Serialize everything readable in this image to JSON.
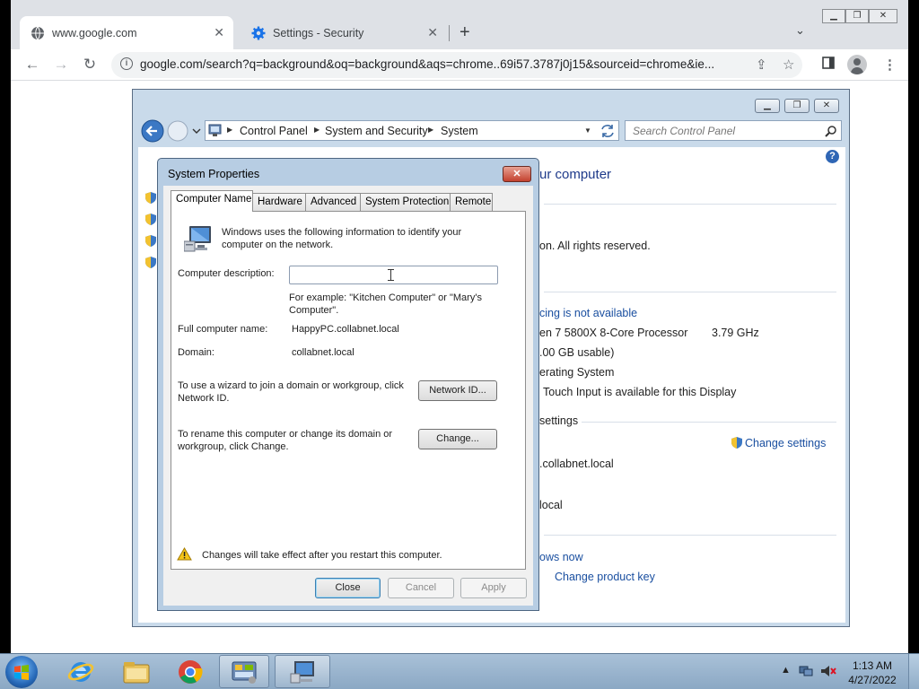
{
  "browser": {
    "tabs": [
      {
        "title": "www.google.com",
        "icon": "globe-icon"
      },
      {
        "title": "Settings - Security",
        "icon": "gear-icon"
      }
    ],
    "url": "google.com/search?q=background&oq=background&aqs=chrome..69i57.3787j0j15&sourceid=chrome&ie...",
    "accent": "#1a73e8"
  },
  "control_panel": {
    "breadcrumb": [
      "Control Panel",
      "System and Security",
      "System"
    ],
    "search_placeholder": "Search Control Panel",
    "content": {
      "heading_fragment": "ur computer",
      "copyright_fragment": "on.  All rights reserved.",
      "pen_fragment": "cing is not available",
      "processor_fragment": "en 7 5800X 8-Core Processor",
      "processor_speed": "3.79 GHz",
      "ram_fragment": ".00 GB usable)",
      "system_type_fragment": "erating System",
      "touch_fragment": "Touch Input is available for this Display",
      "settings_fragment": "settings",
      "change_settings": "Change settings",
      "computer_fragment": ".collabnet.local",
      "domain_fragment": "local",
      "activation_fragment": "ows now",
      "change_product_key": "Change product key"
    }
  },
  "system_properties": {
    "title": "System Properties",
    "tabs": [
      "Computer Name",
      "Hardware",
      "Advanced",
      "System Protection",
      "Remote"
    ],
    "intro": "Windows uses the following information to identify your computer on the network.",
    "description_label": "Computer description:",
    "description_value": "",
    "example": "For example: \"Kitchen Computer\" or \"Mary's Computer\".",
    "full_name_label": "Full computer name:",
    "full_name_value": "HappyPC.collabnet.local",
    "domain_label": "Domain:",
    "domain_value": "collabnet.local",
    "wizard_text": "To use a wizard to join a domain or workgroup, click Network ID.",
    "network_id_button": "Network ID...",
    "rename_text": "To rename this computer or change its domain or workgroup, click Change.",
    "change_button": "Change...",
    "warning": "Changes will take effect after you restart this computer.",
    "buttons": {
      "close": "Close",
      "cancel": "Cancel",
      "apply": "Apply"
    }
  },
  "taskbar": {
    "time": "1:13 AM",
    "date": "4/27/2022"
  }
}
